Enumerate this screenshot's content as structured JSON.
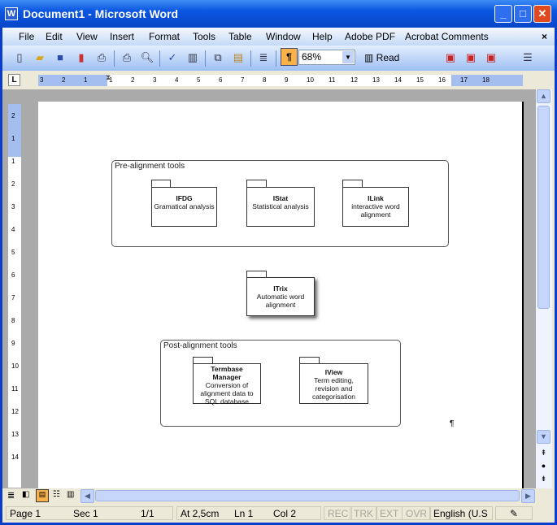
{
  "window": {
    "title": "Document1 - Microsoft Word",
    "buttons": {
      "minimize": "_",
      "maximize": "□",
      "close": "✕"
    }
  },
  "menu": [
    "File",
    "Edit",
    "View",
    "Insert",
    "Format",
    "Tools",
    "Table",
    "Window",
    "Help",
    "Adobe PDF",
    "Acrobat Comments"
  ],
  "menu_close": "×",
  "toolbar": {
    "zoom": "68%",
    "read": "Read",
    "pilcrow": "¶"
  },
  "ruler": {
    "h_ticks": [
      "3",
      "2",
      "1",
      "1",
      "2",
      "3",
      "4",
      "5",
      "6",
      "7",
      "8",
      "9",
      "10",
      "11",
      "12",
      "13",
      "14",
      "15",
      "16",
      "17",
      "18"
    ],
    "v_ticks": [
      "2",
      "1",
      "1",
      "2",
      "3",
      "4",
      "5",
      "6",
      "7",
      "8",
      "9",
      "10",
      "11",
      "12",
      "13",
      "14"
    ],
    "tab_selector": "L"
  },
  "diagram": {
    "pre": {
      "label": "Pre-alignment tools",
      "packages": [
        {
          "name": "IFDG",
          "desc": "Gramatical analysis"
        },
        {
          "name": "IStat",
          "desc": "Statistical analysis"
        },
        {
          "name": "ILink",
          "desc": "interactive word alignment"
        }
      ]
    },
    "center": {
      "name": "ITrix",
      "desc": "Automatic word alignment"
    },
    "post": {
      "label": "Post-alignment tools",
      "packages": [
        {
          "name": "Termbase Manager",
          "desc": "Conversion of alignment data to SQL database"
        },
        {
          "name": "IView",
          "desc": "Term editing, revision and categorisation"
        }
      ]
    },
    "pilcrow": "¶"
  },
  "status": {
    "page": "Page 1",
    "sec": "Sec 1",
    "pages": "1/1",
    "at": "At 2,5cm",
    "ln": "Ln 1",
    "col": "Col 2",
    "rec": "REC",
    "trk": "TRK",
    "ext": "EXT",
    "ovr": "OVR",
    "lang": "English (U.S"
  },
  "colors": {
    "title_bar": "#0a55e0",
    "toolbar": "#c4daf7",
    "active_button": "#f9b24a"
  }
}
